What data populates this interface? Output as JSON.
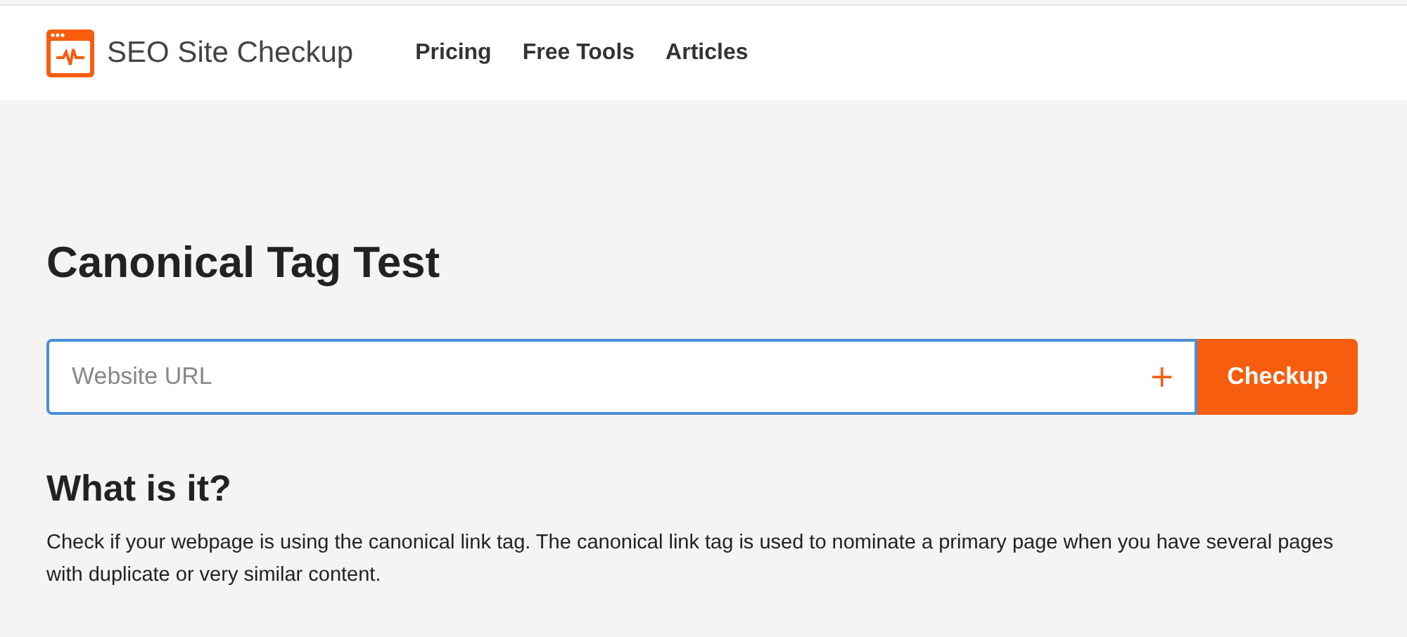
{
  "header": {
    "brand": "SEO Site Checkup",
    "nav": [
      "Pricing",
      "Free Tools",
      "Articles"
    ]
  },
  "title": "Canonical Tag Test",
  "search": {
    "placeholder": "Website URL",
    "add_symbol": "+",
    "button": "Checkup"
  },
  "info": {
    "heading": "What is it?",
    "text": "Check if your webpage is using the canonical link tag. The canonical link tag is used to nominate a primary page when you have several pages with duplicate or very similar content."
  }
}
